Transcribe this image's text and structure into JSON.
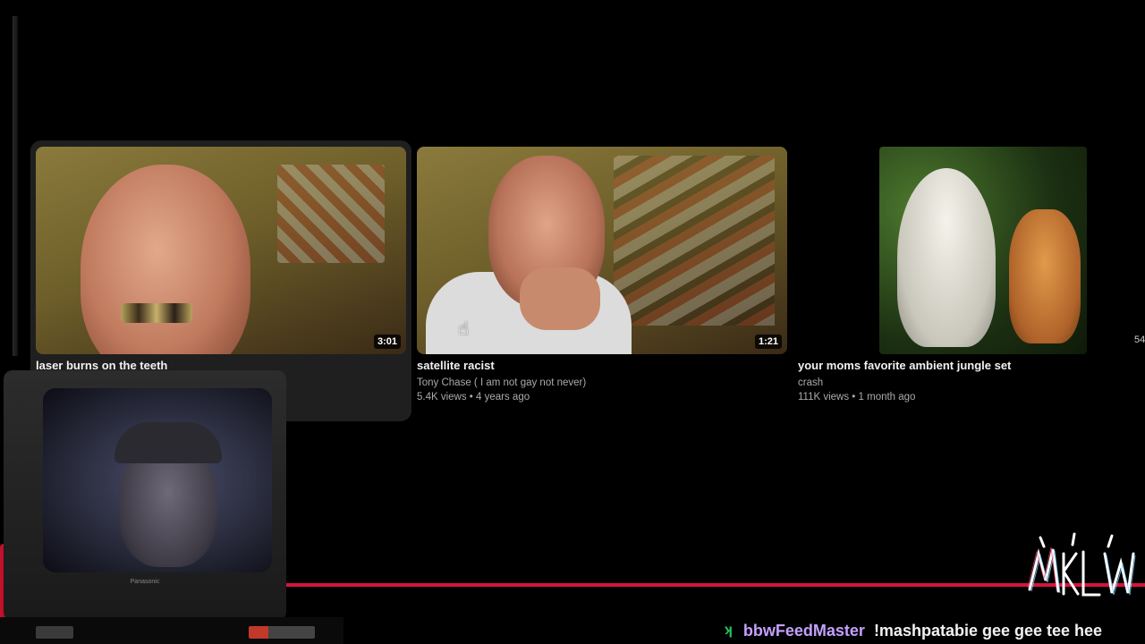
{
  "videos": [
    {
      "title": "laser burns on the teeth",
      "duration": "3:01",
      "channel": "",
      "meta": ""
    },
    {
      "title": "satellite racist",
      "duration": "1:21",
      "channel": "Tony Chase ( I am not gay not never)",
      "meta": "5.4K views • 4 years ago"
    },
    {
      "title": "your moms favorite ambient jungle set",
      "duration": "",
      "channel": "crash",
      "meta": "111K views • 1 month ago"
    }
  ],
  "edge_count": "54",
  "tv_brand": "Panasonic",
  "chat": {
    "badge_icon": "kick-icon",
    "username": "bbwFeedMaster",
    "message": "!mashpatabie gee gee tee hee"
  },
  "colors": {
    "accent_line": "#d4163c",
    "chat_username": "#c4a0ff",
    "chat_badge": "#22c55e"
  }
}
